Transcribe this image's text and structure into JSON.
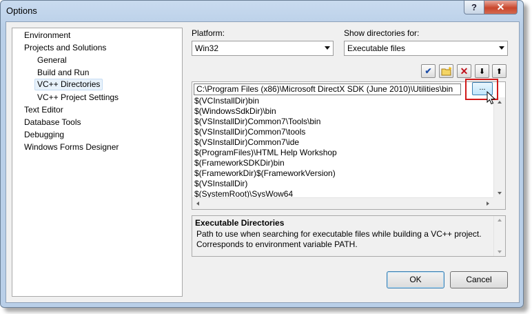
{
  "window": {
    "title": "Options",
    "help_glyph": "?",
    "close_glyph": "✕"
  },
  "tree": {
    "items": [
      {
        "label": "Environment"
      },
      {
        "label": "Projects and Solutions"
      },
      {
        "label": "General"
      },
      {
        "label": "Build and Run"
      },
      {
        "label": "VC++ Directories",
        "selected": true
      },
      {
        "label": "VC++ Project Settings"
      },
      {
        "label": "Text Editor"
      },
      {
        "label": "Database Tools"
      },
      {
        "label": "Debugging"
      },
      {
        "label": "Windows Forms Designer"
      }
    ]
  },
  "platform": {
    "label": "Platform:",
    "value": "Win32"
  },
  "show_dirs": {
    "label": "Show directories for:",
    "value": "Executable files"
  },
  "toolbar": {
    "check_glyph": "✔",
    "delete_glyph": "✕",
    "down_glyph": "⬇",
    "up_glyph": "⬆"
  },
  "directories": {
    "editing": "C:\\Program Files (x86)\\Microsoft DirectX SDK (June 2010)\\Utilities\\bin",
    "browse_label": "...",
    "rows": [
      "$(VCInstallDir)bin",
      "$(WindowsSdkDir)\\bin",
      "$(VSInstallDir)Common7\\Tools\\bin",
      "$(VSInstallDir)Common7\\tools",
      "$(VSInstallDir)Common7\\ide",
      "$(ProgramFiles)\\HTML Help Workshop",
      "$(FrameworkSDKDir)bin",
      "$(FrameworkDir)$(FrameworkVersion)",
      "$(VSInstallDir)",
      "$(SystemRoot)\\SysWow64"
    ]
  },
  "description": {
    "title": "Executable Directories",
    "text": "Path to use when searching for executable files while building a VC++ project. Corresponds to environment variable PATH."
  },
  "buttons": {
    "ok": "OK",
    "cancel": "Cancel"
  }
}
